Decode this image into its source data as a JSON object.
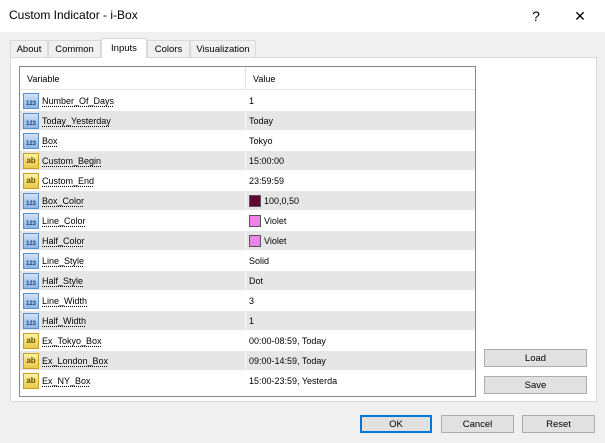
{
  "window": {
    "title": "Custom Indicator - i-Box",
    "help_label": "?",
    "close_label": "✕"
  },
  "tabs": [
    {
      "label": "About"
    },
    {
      "label": "Common"
    },
    {
      "label": "Inputs"
    },
    {
      "label": "Colors"
    },
    {
      "label": "Visualization"
    }
  ],
  "grid": {
    "header_variable": "Variable",
    "header_value": "Value",
    "rows": [
      {
        "type": "int",
        "icon_text": "123",
        "variable": "Number_Of_Days",
        "value": "1"
      },
      {
        "type": "int",
        "icon_text": "123",
        "variable": "Today_Yesterday",
        "value": "Today"
      },
      {
        "type": "int",
        "icon_text": "123",
        "variable": "Box",
        "value": "Tokyo"
      },
      {
        "type": "str",
        "icon_text": "ab",
        "variable": "Custom_Begin",
        "value": "15:00:00"
      },
      {
        "type": "str",
        "icon_text": "ab",
        "variable": "Custom_End",
        "value": "23:59:59"
      },
      {
        "type": "int",
        "icon_text": "123",
        "variable": "Box_Color",
        "value": "100,0,50",
        "color": "#640032"
      },
      {
        "type": "int",
        "icon_text": "123",
        "variable": "Line_Color",
        "value": "Violet",
        "color": "#ee82ee"
      },
      {
        "type": "int",
        "icon_text": "123",
        "variable": "Half_Color",
        "value": "Violet",
        "color": "#ee82ee"
      },
      {
        "type": "int",
        "icon_text": "123",
        "variable": "Line_Style",
        "value": "Solid"
      },
      {
        "type": "int",
        "icon_text": "123",
        "variable": "Half_Style",
        "value": "Dot"
      },
      {
        "type": "int",
        "icon_text": "123",
        "variable": "Line_Width",
        "value": "3"
      },
      {
        "type": "int",
        "icon_text": "123",
        "variable": "Half_Width",
        "value": "1"
      },
      {
        "type": "str",
        "icon_text": "ab",
        "variable": "Ex_Tokyo_Box",
        "value": "00:00-08:59, Today"
      },
      {
        "type": "str",
        "icon_text": "ab",
        "variable": "Ex_London_Box",
        "value": "09:00-14:59, Today"
      },
      {
        "type": "str",
        "icon_text": "ab",
        "variable": "Ex_NY_Box",
        "value": "15:00-23:59, Yesterda"
      }
    ]
  },
  "side_buttons": {
    "load_label": "Load",
    "save_label": "Save"
  },
  "footer_buttons": {
    "ok_label": "OK",
    "cancel_label": "Cancel",
    "reset_label": "Reset"
  },
  "colors": {
    "accent": "#0078d7",
    "alt_row": "#e6e6e6"
  }
}
